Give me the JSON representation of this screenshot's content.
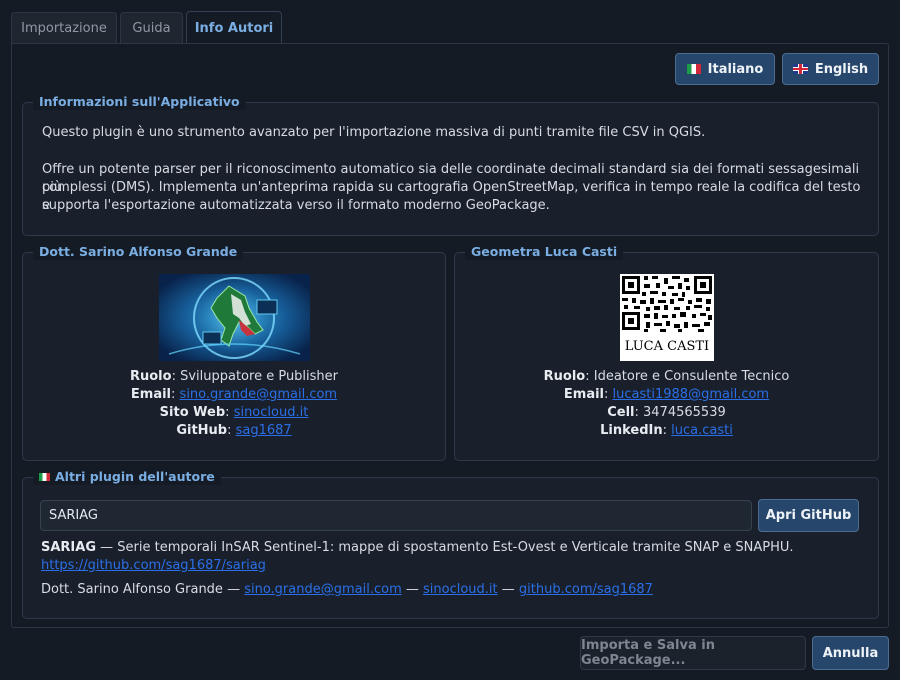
{
  "tabs": [
    {
      "label": "Importazione"
    },
    {
      "label": "Guida"
    },
    {
      "label": "Info Autori"
    }
  ],
  "language": {
    "italian": "Italiano",
    "english": "English"
  },
  "app_info": {
    "title": "Informazioni sull'Applicativo",
    "paragraph1": "Questo plugin è uno strumento avanzato per l'importazione massiva di punti tramite file CSV in QGIS.",
    "paragraph2_line1": "Offre un potente parser per il riconoscimento automatico sia delle coordinate decimali standard sia dei formati sessagesimali più",
    "paragraph2_line2": "complessi (DMS). Implementa un'anteprima rapida su cartografia OpenStreetMap, verifica in tempo reale la codifica del testo e",
    "paragraph2_line3": "supporta l'esportazione automatizzata verso il formato moderno GeoPackage."
  },
  "author1": {
    "title": "Dott. Sarino Alfonso Grande",
    "role_label": "Ruolo",
    "role": "Sviluppatore e Publisher",
    "email_label": "Email",
    "email": "sino.grande@gmail.com",
    "site_label": "Sito Web",
    "site": "sinocloud.it",
    "github_label": "GitHub",
    "github": "sag1687"
  },
  "author2": {
    "title": "Geometra Luca Casti",
    "qr_caption": "LUCA CASTI",
    "role_label": "Ruolo",
    "role": "Ideatore e Consulente Tecnico",
    "email_label": "Email",
    "email": "lucasti1988@gmail.com",
    "cell_label": "Cell",
    "cell": "3474565539",
    "linkedin_label": "LinkedIn",
    "linkedin": "luca.casti"
  },
  "other_plugins": {
    "title": "Altri plugin dell'autore",
    "selected": "SARIAG",
    "open_button": "Apri GitHub",
    "plugin_name": "SARIAG",
    "plugin_desc": " — Serie temporali InSAR Sentinel-1: mappe di spostamento Est-Ovest e Verticale tramite SNAP e SNAPHU.",
    "plugin_link": "https://github.com/sag1687/sariag",
    "author_name": "Dott. Sarino Alfonso Grande — ",
    "author_email": "sino.grande@gmail.com",
    "sep1": " — ",
    "author_site": "sinocloud.it",
    "sep2": " — ",
    "author_github": "github.com/sag1687"
  },
  "footer": {
    "import_button": "Importa e Salva in GeoPackage...",
    "cancel_button": "Annulla"
  },
  "colors": {
    "accent": "#7aaee3",
    "link": "#2b6fe8",
    "button": "#27466b"
  }
}
